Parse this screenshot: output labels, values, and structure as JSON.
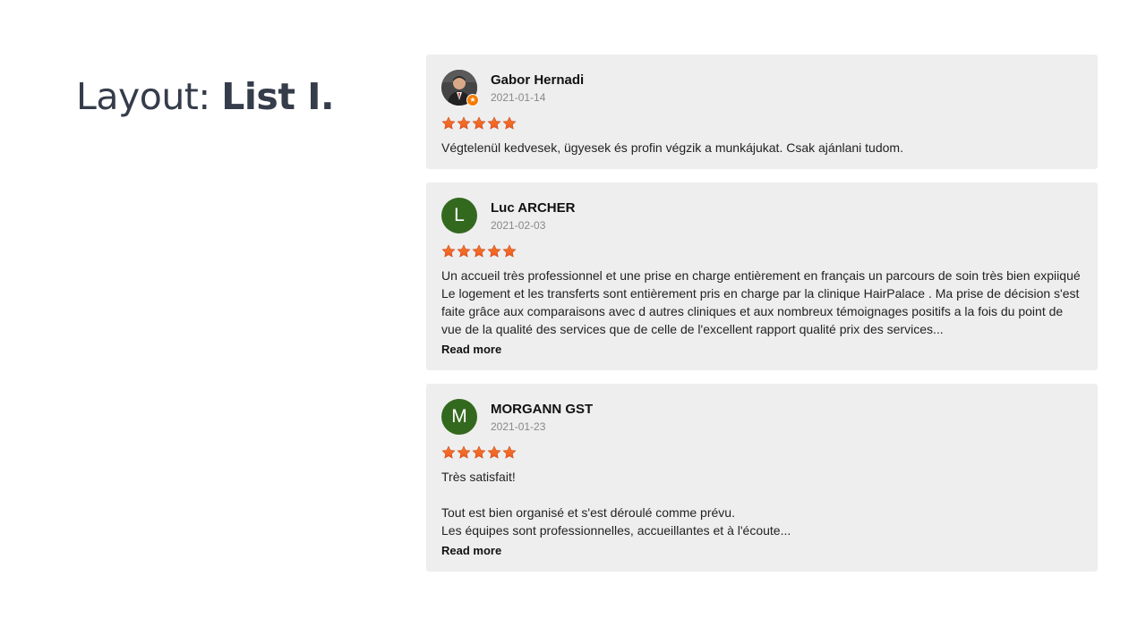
{
  "heading": {
    "prefix": "Layout: ",
    "strong": "List I."
  },
  "colors": {
    "star": "#f05a1e",
    "avatar_bg": "#33691e",
    "card_bg": "#eeeeee",
    "heading": "#353c4a"
  },
  "reviews": [
    {
      "name": "Gabor Hernadi",
      "date": "2021-01-14",
      "avatar_type": "photo",
      "rating": 5,
      "text": "Végtelenül kedvesek, ügyesek és profin végzik a munkájukat. Csak ajánlani tudom.",
      "read_more": ""
    },
    {
      "name": "Luc ARCHER",
      "date": "2021-02-03",
      "avatar_type": "letter",
      "avatar_letter": "L",
      "rating": 5,
      "text": "Un accueil très professionnel et une prise en charge entièrement en français un parcours de soin très bien expiiqué Le logement et les transferts sont entièrement pris en charge par la clinique HairPalace . Ma prise de décision s'est faite grâce aux comparaisons avec d autres cliniques et aux nombreux témoignages positifs a la fois du point de vue de la qualité des services que de celle de l'excellent rapport qualité prix des services...",
      "read_more": "Read more"
    },
    {
      "name": "MORGANN GST",
      "date": "2021-01-23",
      "avatar_type": "letter",
      "avatar_letter": "M",
      "rating": 5,
      "text": "Très satisfait!\n\nTout est bien organisé et s'est déroulé comme prévu.\nLes équipes sont professionnelles, accueillantes et à l'écoute...",
      "read_more": "Read more"
    }
  ]
}
